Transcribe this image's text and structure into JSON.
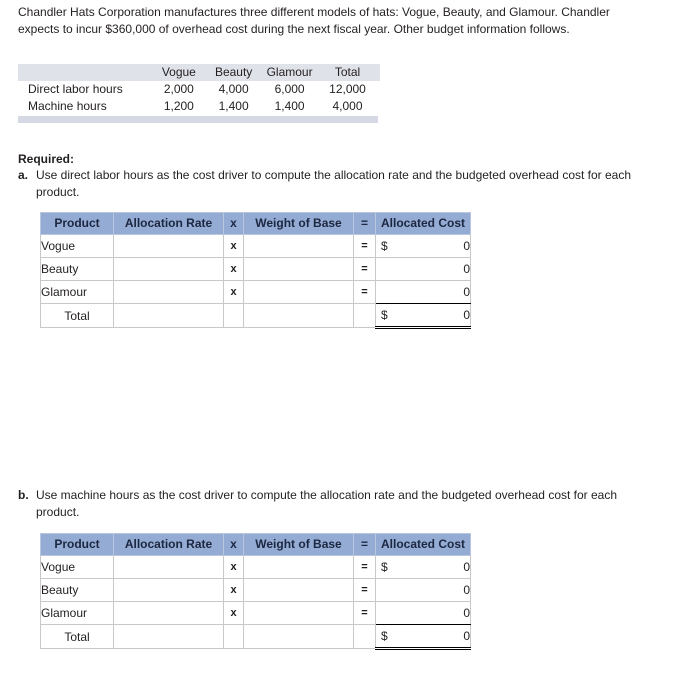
{
  "intro": "Chandler Hats Corporation manufactures three different models of hats: Vogue, Beauty, and Glamour. Chandler expects to incur $360,000 of overhead cost during the next fiscal year. Other budget information follows.",
  "budget_table": {
    "corner_label": "",
    "columns": [
      "Vogue",
      "Beauty",
      "Glamour",
      "Total"
    ],
    "rows": [
      {
        "label": "Direct labor hours",
        "values": [
          "2,000",
          "4,000",
          "6,000",
          "12,000"
        ]
      },
      {
        "label": "Machine hours",
        "values": [
          "1,200",
          "1,400",
          "1,400",
          "4,000"
        ]
      }
    ]
  },
  "required": {
    "heading": "Required:",
    "items": [
      {
        "marker": "a.",
        "text": "Use direct labor hours as the cost driver to compute the allocation rate and the budgeted overhead cost for each product."
      },
      {
        "marker": "b.",
        "text": "Use machine hours as the cost driver to compute the allocation rate and the budgeted overhead cost for each product."
      }
    ]
  },
  "answer_tables": [
    {
      "id": "a",
      "headers": [
        "Product",
        "Allocation Rate",
        "x",
        "Weight of Base",
        "=",
        "Allocated Cost"
      ],
      "rows": [
        {
          "product": "Vogue",
          "allocation_rate": "",
          "op_mult": "x",
          "weight_of_base": "",
          "op_eq": "=",
          "currency": "$",
          "allocated_cost": "0"
        },
        {
          "product": "Beauty",
          "allocation_rate": "",
          "op_mult": "x",
          "weight_of_base": "",
          "op_eq": "=",
          "currency": "",
          "allocated_cost": "0"
        },
        {
          "product": "Glamour",
          "allocation_rate": "",
          "op_mult": "x",
          "weight_of_base": "",
          "op_eq": "=",
          "currency": "",
          "allocated_cost": "0"
        }
      ],
      "total_row": {
        "product": "Total",
        "allocation_rate": "",
        "op_mult": "",
        "weight_of_base": "",
        "op_eq": "",
        "currency": "$",
        "allocated_cost": "0"
      }
    },
    {
      "id": "b",
      "headers": [
        "Product",
        "Allocation Rate",
        "x",
        "Weight of Base",
        "=",
        "Allocated Cost"
      ],
      "rows": [
        {
          "product": "Vogue",
          "allocation_rate": "",
          "op_mult": "x",
          "weight_of_base": "",
          "op_eq": "=",
          "currency": "$",
          "allocated_cost": "0"
        },
        {
          "product": "Beauty",
          "allocation_rate": "",
          "op_mult": "x",
          "weight_of_base": "",
          "op_eq": "=",
          "currency": "",
          "allocated_cost": "0"
        },
        {
          "product": "Glamour",
          "allocation_rate": "",
          "op_mult": "x",
          "weight_of_base": "",
          "op_eq": "=",
          "currency": "",
          "allocated_cost": "0"
        }
      ],
      "total_row": {
        "product": "Total",
        "allocation_rate": "",
        "op_mult": "",
        "weight_of_base": "",
        "op_eq": "",
        "currency": "$",
        "allocated_cost": "0"
      }
    }
  ],
  "colors": {
    "header_blue": "#94abd4",
    "header_text": "#1c2740",
    "input_border_yellow": "#fff000",
    "budget_header_gray": "#dfe2e9",
    "budget_footer_gray": "#d5d9e3",
    "grid_line": "#c8c8c8",
    "text": "#231f20"
  }
}
